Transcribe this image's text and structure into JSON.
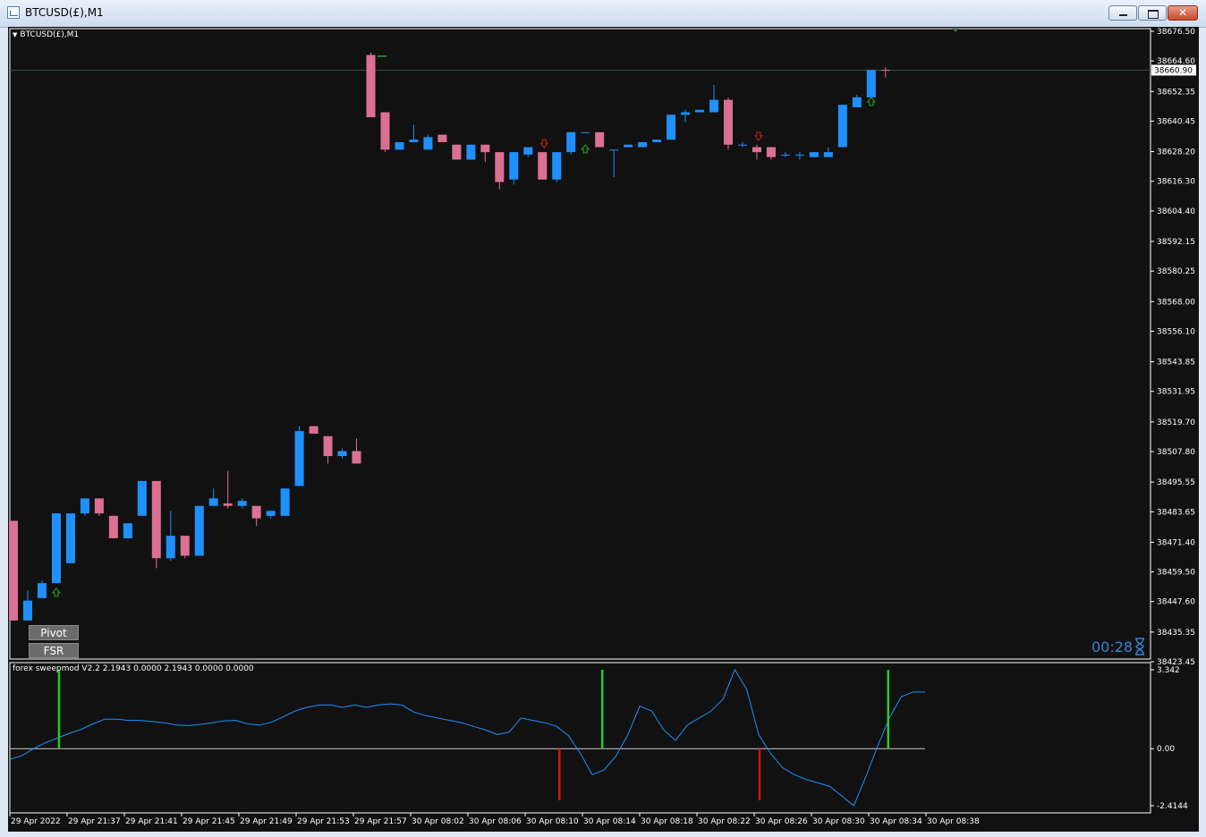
{
  "window": {
    "title": "BTCUSD(£),M1"
  },
  "chart": {
    "label": "BTCUSD(£),M1",
    "current_price": "38660.90",
    "countdown": "00:28",
    "price_axis": [
      "38676.50",
      "38664.60",
      "38652.35",
      "38640.45",
      "38628.20",
      "38616.30",
      "38604.40",
      "38592.15",
      "38580.25",
      "38568.00",
      "38556.10",
      "38543.85",
      "38531.95",
      "38519.70",
      "38507.80",
      "38495.55",
      "38483.65",
      "38471.40",
      "38459.50",
      "38447.60",
      "38435.35",
      "38423.45"
    ],
    "time_axis": [
      "29 Apr 2022",
      "29 Apr 21:37",
      "29 Apr 21:41",
      "29 Apr 21:45",
      "29 Apr 21:49",
      "29 Apr 21:53",
      "29 Apr 21:57",
      "30 Apr 08:02",
      "30 Apr 08:06",
      "30 Apr 08:10",
      "30 Apr 08:14",
      "30 Apr 08:18",
      "30 Apr 08:22",
      "30 Apr 08:26",
      "30 Apr 08:30",
      "30 Apr 08:34",
      "30 Apr 08:38"
    ],
    "buttons": {
      "pivot": "Pivot",
      "fsr": "FSR"
    },
    "colors": {
      "background": "#111111",
      "bull": "#1e90ff",
      "bear": "#db7093",
      "grid_line": "#2f4f4f",
      "up_arrow": "#22aa22",
      "down_arrow": "#cc2222",
      "axis_text": "#ffffff"
    }
  },
  "indicator": {
    "label": "forex sweepmod V2.2 2.1943 0.0000 2.1943 0.0000 0.0000",
    "axis": [
      "3.342",
      "0.00",
      "-2.4144"
    ],
    "colors": {
      "line": "#1e90ff",
      "buy_bar": "#22cc22",
      "sell_bar": "#dd1111",
      "zero_line": "#cccccc"
    }
  },
  "chart_data": {
    "type": "candlestick",
    "ylim": [
      38423.45,
      38676.5
    ],
    "candles": [
      {
        "o": 38480.0,
        "h": 38480.0,
        "c": 38440.0,
        "l": 38440.0
      },
      {
        "o": 38440.0,
        "h": 38452.0,
        "c": 38448.0,
        "l": 38440.0
      },
      {
        "o": 38449.0,
        "h": 38456.0,
        "c": 38455.0,
        "l": 38449.0
      },
      {
        "o": 38455.0,
        "h": 38483.0,
        "c": 38483.0,
        "l": 38455.0
      },
      {
        "o": 38463.0,
        "h": 38483.0,
        "c": 38483.0,
        "l": 38463.0
      },
      {
        "o": 38483.0,
        "h": 38489.0,
        "c": 38489.0,
        "l": 38482.0
      },
      {
        "o": 38489.0,
        "h": 38489.0,
        "c": 38483.0,
        "l": 38482.0
      },
      {
        "o": 38482.0,
        "h": 38482.0,
        "c": 38473.0,
        "l": 38473.0
      },
      {
        "o": 38473.0,
        "h": 38479.0,
        "c": 38479.0,
        "l": 38473.0
      },
      {
        "o": 38482.0,
        "h": 38496.0,
        "c": 38496.0,
        "l": 38482.0
      },
      {
        "o": 38496.0,
        "h": 38496.0,
        "c": 38465.0,
        "l": 38461.0
      },
      {
        "o": 38465.0,
        "h": 38484.0,
        "c": 38474.0,
        "l": 38464.0
      },
      {
        "o": 38474.0,
        "h": 38474.0,
        "c": 38466.0,
        "l": 38465.0
      },
      {
        "o": 38466.0,
        "h": 38486.0,
        "c": 38486.0,
        "l": 38466.0
      },
      {
        "o": 38486.0,
        "h": 38493.0,
        "c": 38489.0,
        "l": 38486.0
      },
      {
        "o": 38487.0,
        "h": 38500.0,
        "c": 38486.0,
        "l": 38485.0
      },
      {
        "o": 38486.0,
        "h": 38489.0,
        "c": 38488.0,
        "l": 38485.0
      },
      {
        "o": 38486.0,
        "h": 38486.0,
        "c": 38481.0,
        "l": 38478.0
      },
      {
        "o": 38482.0,
        "h": 38484.0,
        "c": 38484.0,
        "l": 38481.0
      },
      {
        "o": 38482.0,
        "h": 38493.0,
        "c": 38493.0,
        "l": 38482.0
      },
      {
        "o": 38494.0,
        "h": 38518.0,
        "c": 38516.0,
        "l": 38494.0
      },
      {
        "o": 38518.0,
        "h": 38518.0,
        "c": 38515.0,
        "l": 38515.0
      },
      {
        "o": 38514.0,
        "h": 38514.0,
        "c": 38506.0,
        "l": 38503.0
      },
      {
        "o": 38506.0,
        "h": 38509.0,
        "c": 38508.0,
        "l": 38505.0
      },
      {
        "o": 38508.0,
        "h": 38513.0,
        "c": 38503.0,
        "l": 38503.0
      },
      {
        "o": 38667.0,
        "h": 38668.0,
        "c": 38642.0,
        "l": 38642.0
      },
      {
        "o": 38644.0,
        "h": 38644.0,
        "c": 38629.0,
        "l": 38628.0
      },
      {
        "o": 38629.0,
        "h": 38632.0,
        "c": 38632.0,
        "l": 38629.0
      },
      {
        "o": 38632.0,
        "h": 38639.0,
        "c": 38633.0,
        "l": 38632.0
      },
      {
        "o": 38629.0,
        "h": 38635.0,
        "c": 38634.0,
        "l": 38629.0
      },
      {
        "o": 38635.0,
        "h": 38635.0,
        "c": 38632.0,
        "l": 38632.0
      },
      {
        "o": 38631.0,
        "h": 38631.0,
        "c": 38625.0,
        "l": 38625.0
      },
      {
        "o": 38625.0,
        "h": 38631.0,
        "c": 38631.0,
        "l": 38625.0
      },
      {
        "o": 38631.0,
        "h": 38631.0,
        "c": 38628.0,
        "l": 38624.0
      },
      {
        "o": 38628.0,
        "h": 38628.0,
        "c": 38616.0,
        "l": 38613.0
      },
      {
        "o": 38617.0,
        "h": 38628.0,
        "c": 38628.0,
        "l": 38615.0
      },
      {
        "o": 38627.0,
        "h": 38630.0,
        "c": 38630.0,
        "l": 38626.0
      },
      {
        "o": 38628.0,
        "h": 38628.0,
        "c": 38617.0,
        "l": 38617.0
      },
      {
        "o": 38617.0,
        "h": 38628.0,
        "c": 38628.0,
        "l": 38616.0
      },
      {
        "o": 38628.0,
        "h": 38636.0,
        "c": 38636.0,
        "l": 38627.0
      },
      {
        "o": 38636.0,
        "h": 38636.0,
        "c": 38636.0,
        "l": 38636.0
      },
      {
        "o": 38636.0,
        "h": 38636.0,
        "c": 38630.0,
        "l": 38630.0
      },
      {
        "o": 38629.0,
        "h": 38629.0,
        "c": 38629.0,
        "l": 38618.0
      },
      {
        "o": 38630.0,
        "h": 38631.0,
        "c": 38631.0,
        "l": 38630.0
      },
      {
        "o": 38630.0,
        "h": 38632.0,
        "c": 38632.0,
        "l": 38630.0
      },
      {
        "o": 38632.0,
        "h": 38633.0,
        "c": 38633.0,
        "l": 38632.0
      },
      {
        "o": 38633.0,
        "h": 38643.0,
        "c": 38643.0,
        "l": 38633.0
      },
      {
        "o": 38643.0,
        "h": 38645.0,
        "c": 38644.0,
        "l": 38640.0
      },
      {
        "o": 38644.0,
        "h": 38645.0,
        "c": 38645.0,
        "l": 38644.0
      },
      {
        "o": 38644.0,
        "h": 38655.0,
        "c": 38649.0,
        "l": 38644.0
      },
      {
        "o": 38649.0,
        "h": 38650.0,
        "c": 38631.0,
        "l": 38629.0
      },
      {
        "o": 38631.0,
        "h": 38632.0,
        "c": 38631.0,
        "l": 38630.0
      },
      {
        "o": 38630.0,
        "h": 38631.0,
        "c": 38628.0,
        "l": 38625.0
      },
      {
        "o": 38630.0,
        "h": 38630.0,
        "c": 38626.0,
        "l": 38625.0
      },
      {
        "o": 38627.0,
        "h": 38628.0,
        "c": 38627.0,
        "l": 38626.0
      },
      {
        "o": 38627.0,
        "h": 38628.0,
        "c": 38627.0,
        "l": 38625.0
      },
      {
        "o": 38626.0,
        "h": 38628.0,
        "c": 38628.0,
        "l": 38626.0
      },
      {
        "o": 38626.0,
        "h": 38630.0,
        "c": 38628.0,
        "l": 38626.0
      },
      {
        "o": 38630.0,
        "h": 38647.0,
        "c": 38647.0,
        "l": 38630.0
      },
      {
        "o": 38646.0,
        "h": 38651.0,
        "c": 38650.0,
        "l": 38646.0
      },
      {
        "o": 38650.0,
        "h": 38661.0,
        "c": 38661.0,
        "l": 38650.0
      },
      {
        "o": 38661.0,
        "h": 38662.0,
        "c": 38660.9,
        "l": 38658.0
      }
    ],
    "up_arrows_at": [
      2,
      39,
      59
    ],
    "down_arrows_at": [
      37,
      52
    ],
    "indicator_series": [
      -0.45,
      -0.3,
      0.0,
      0.25,
      0.45,
      0.65,
      0.82,
      1.05,
      1.25,
      1.25,
      1.2,
      1.2,
      1.15,
      1.1,
      1.0,
      0.98,
      1.02,
      1.1,
      1.18,
      1.2,
      1.05,
      1.0,
      1.12,
      1.35,
      1.6,
      1.75,
      1.85,
      1.85,
      1.75,
      1.85,
      1.75,
      1.85,
      1.9,
      1.85,
      1.55,
      1.4,
      1.3,
      1.2,
      1.1,
      0.95,
      0.8,
      0.6,
      0.7,
      1.3,
      1.2,
      1.1,
      0.95,
      0.55,
      -0.2,
      -1.1,
      -0.9,
      -0.3,
      0.6,
      1.8,
      1.6,
      0.8,
      0.35,
      1.0,
      1.3,
      1.6,
      2.1,
      3.342,
      2.5,
      0.6,
      -0.2,
      -0.8,
      -1.1,
      -1.3,
      -1.45,
      -1.6,
      -2.0,
      -2.4144,
      -1.2,
      0.1,
      1.3,
      2.2,
      2.4,
      2.4
    ],
    "indicator_ylim": [
      -2.4144,
      3.342
    ],
    "indicator_buy_bars_at": [
      3,
      41,
      61
    ],
    "indicator_sell_bars_at": [
      38,
      52
    ]
  }
}
